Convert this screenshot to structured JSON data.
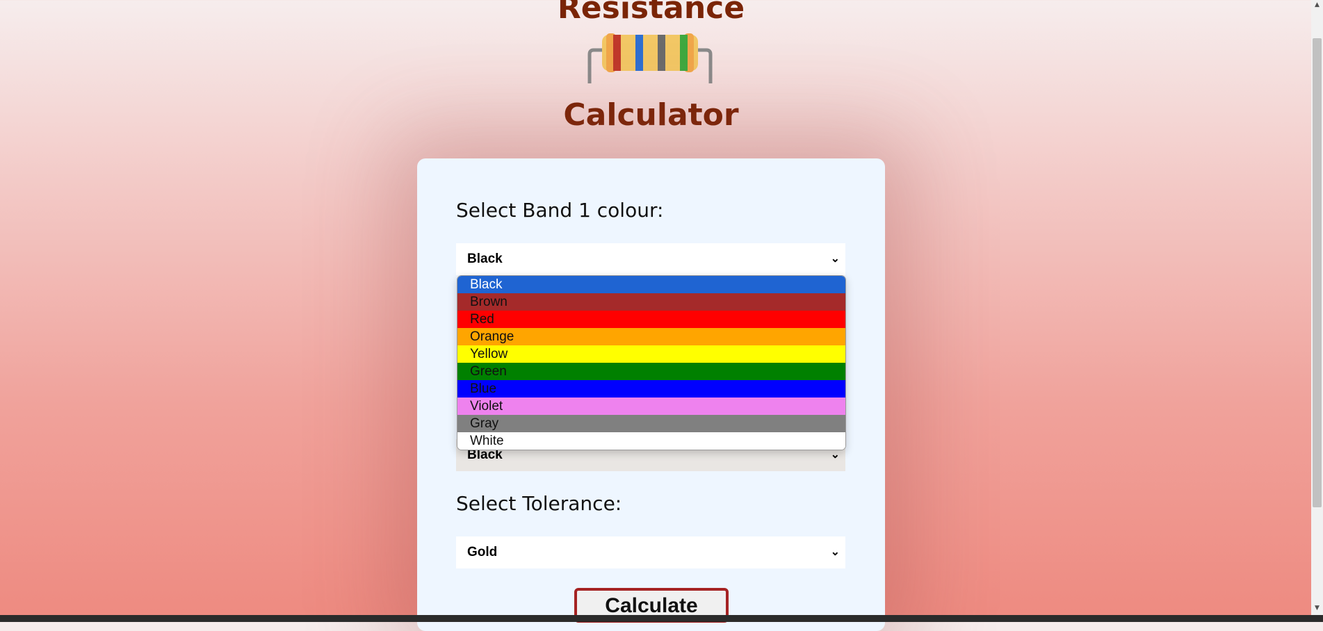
{
  "header": {
    "title_top": "Resistance",
    "title_bottom": "Calculator",
    "resistor_band_colors": [
      "#c0392b",
      "#2f6fd0",
      "#6b6b6b",
      "#3fa83f"
    ]
  },
  "form": {
    "band1_label": "Select Band 1 colour:",
    "band1_value": "Black",
    "band_hidden_value": "Black",
    "tolerance_label": "Select Tolerance:",
    "tolerance_value": "Gold",
    "calculate_label": "Calculate"
  },
  "dropdown": {
    "options": [
      {
        "label": "Black",
        "bg": "#1f64d2",
        "color": "#ffffff"
      },
      {
        "label": "Brown",
        "bg": "#a52a2a",
        "color": "#111111"
      },
      {
        "label": "Red",
        "bg": "#ff0000",
        "color": "#111111"
      },
      {
        "label": "Orange",
        "bg": "#ffa500",
        "color": "#111111"
      },
      {
        "label": "Yellow",
        "bg": "#ffff00",
        "color": "#111111"
      },
      {
        "label": "Green",
        "bg": "#008000",
        "color": "#111111"
      },
      {
        "label": "Blue",
        "bg": "#0000ff",
        "color": "#111111"
      },
      {
        "label": "Violet",
        "bg": "#ee82ee",
        "color": "#111111"
      },
      {
        "label": "Gray",
        "bg": "#808080",
        "color": "#111111"
      },
      {
        "label": "White",
        "bg": "#ffffff",
        "color": "#111111"
      }
    ]
  }
}
